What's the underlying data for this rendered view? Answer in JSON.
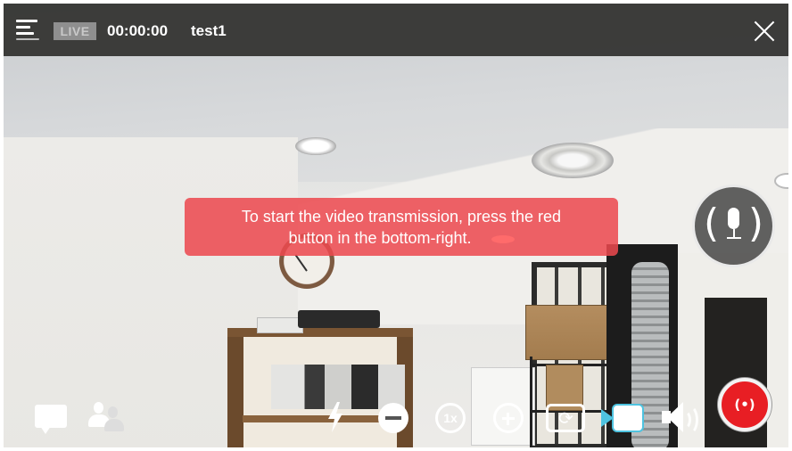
{
  "topbar": {
    "menu_icon": "menu-icon",
    "live_badge": "LIVE",
    "timer": "00:00:00",
    "stream_name": "test1",
    "close_icon": "close-icon"
  },
  "hint": {
    "line1": "To start the video transmission, press the red",
    "line2": "button in the bottom-right."
  },
  "controls": {
    "mic_icon": "microphone-icon",
    "zoom_level": "1x",
    "broadcast_label": "(•)",
    "toolbar_icons": [
      "chat-icon",
      "users-icon",
      "flash-icon",
      "zoom-out-icon",
      "zoom-level",
      "zoom-in-icon",
      "switch-camera-icon",
      "video-icon",
      "speaker-icon",
      "broadcast-icon"
    ]
  },
  "colors": {
    "banner": "#ec484e",
    "broadcast": "#e81e24",
    "video_accent": "#4ec3e0"
  }
}
